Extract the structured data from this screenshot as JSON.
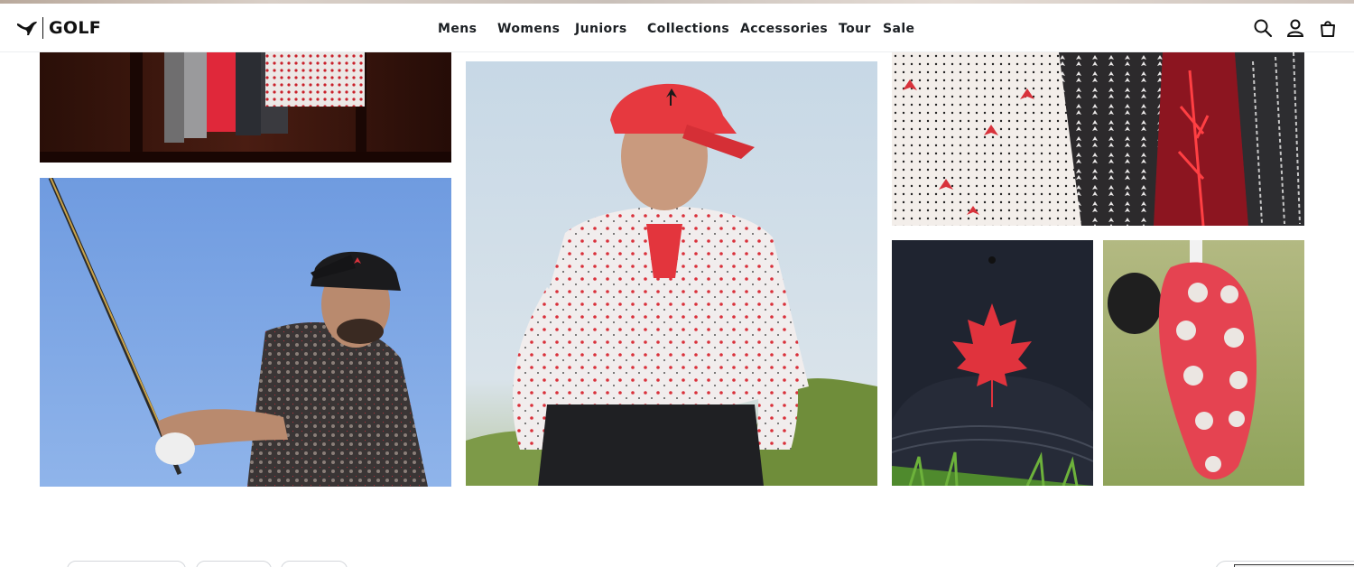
{
  "brand": {
    "name": "GOLF"
  },
  "nav": {
    "items": [
      {
        "label": "Mens"
      },
      {
        "label": "Womens"
      },
      {
        "label": "Juniors"
      },
      {
        "label": "Collections"
      },
      {
        "label": "Accessories"
      },
      {
        "label": "Tour"
      },
      {
        "label": "Sale"
      }
    ]
  },
  "header_icons": [
    "search-icon",
    "account-icon",
    "shopping-bag-icon"
  ],
  "colors": {
    "text": "#1b1f23",
    "accent_red": "#e0333d",
    "background": "#ffffff"
  }
}
